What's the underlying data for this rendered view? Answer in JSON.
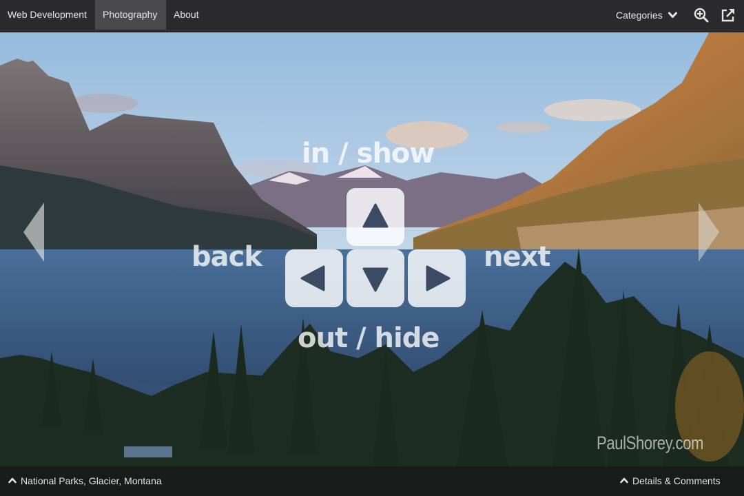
{
  "nav": {
    "items": [
      {
        "label": "Web Development",
        "active": false
      },
      {
        "label": "Photography",
        "active": true
      },
      {
        "label": "About",
        "active": false
      }
    ],
    "categories_label": "Categories",
    "icons": [
      "chevron-down-icon",
      "zoom-in-icon",
      "external-link-icon"
    ]
  },
  "overlay": {
    "up_label": "in / show",
    "left_label": "back",
    "right_label": "next",
    "down_label": "out / hide",
    "keys": [
      "arrow-up-key",
      "arrow-left-key",
      "arrow-down-key",
      "arrow-right-key"
    ]
  },
  "photo": {
    "watermark": "PaulShorey.com",
    "location": "National Parks, Glacier, Montana",
    "details_label": "Details & Comments"
  },
  "colors": {
    "topbar": "#2b2b2d",
    "active_tab": "#4a4a4c",
    "text": "#e6e6e6"
  }
}
